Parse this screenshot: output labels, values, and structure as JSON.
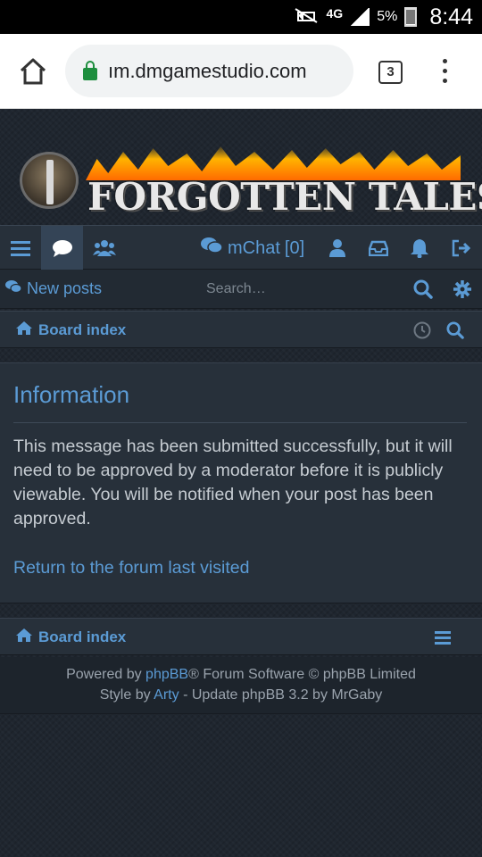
{
  "status_bar": {
    "network": "4G",
    "battery_pct": "5%",
    "time": "8:44"
  },
  "browser": {
    "url": "ım.dmgamestudio.com",
    "tab_count": "3"
  },
  "site": {
    "logo_text": "FORGOTTEN TALES"
  },
  "navbar": {
    "mchat_label": "mChat",
    "mchat_count": "[0]"
  },
  "subbar": {
    "new_posts": "New posts",
    "search_placeholder": "Search…"
  },
  "breadcrumb": {
    "board_index": "Board index"
  },
  "info": {
    "heading": "Information",
    "message": "This message has been submitted successfully, but it will need to be approved by a moderator before it is publicly viewable. You will be notified when your post has been approved.",
    "return_link": "Return to the forum last visited"
  },
  "footer": {
    "powered_prefix": "Powered by ",
    "phpbb_link": "phpBB",
    "powered_suffix": "® Forum Software © phpBB Limited",
    "style_prefix": "Style by ",
    "arty_link": "Arty",
    "style_suffix": " - Update phpBB 3.2 by MrGaby"
  },
  "colors": {
    "accent": "#5b9bd5",
    "panel_bg": "#27303a",
    "page_bg": "#1f262f",
    "text": "#c6ccd2"
  },
  "icons": [
    "mute-icon",
    "signal-icon",
    "battery-icon",
    "home-icon",
    "lock-icon",
    "menu-dots-icon",
    "hamburger-icon",
    "chat-bubble-icon",
    "users-icon",
    "mchat-icon",
    "user-icon",
    "inbox-icon",
    "bell-icon",
    "logout-icon",
    "new-posts-icon",
    "search-icon",
    "gear-icon",
    "house-icon",
    "clock-icon"
  ]
}
